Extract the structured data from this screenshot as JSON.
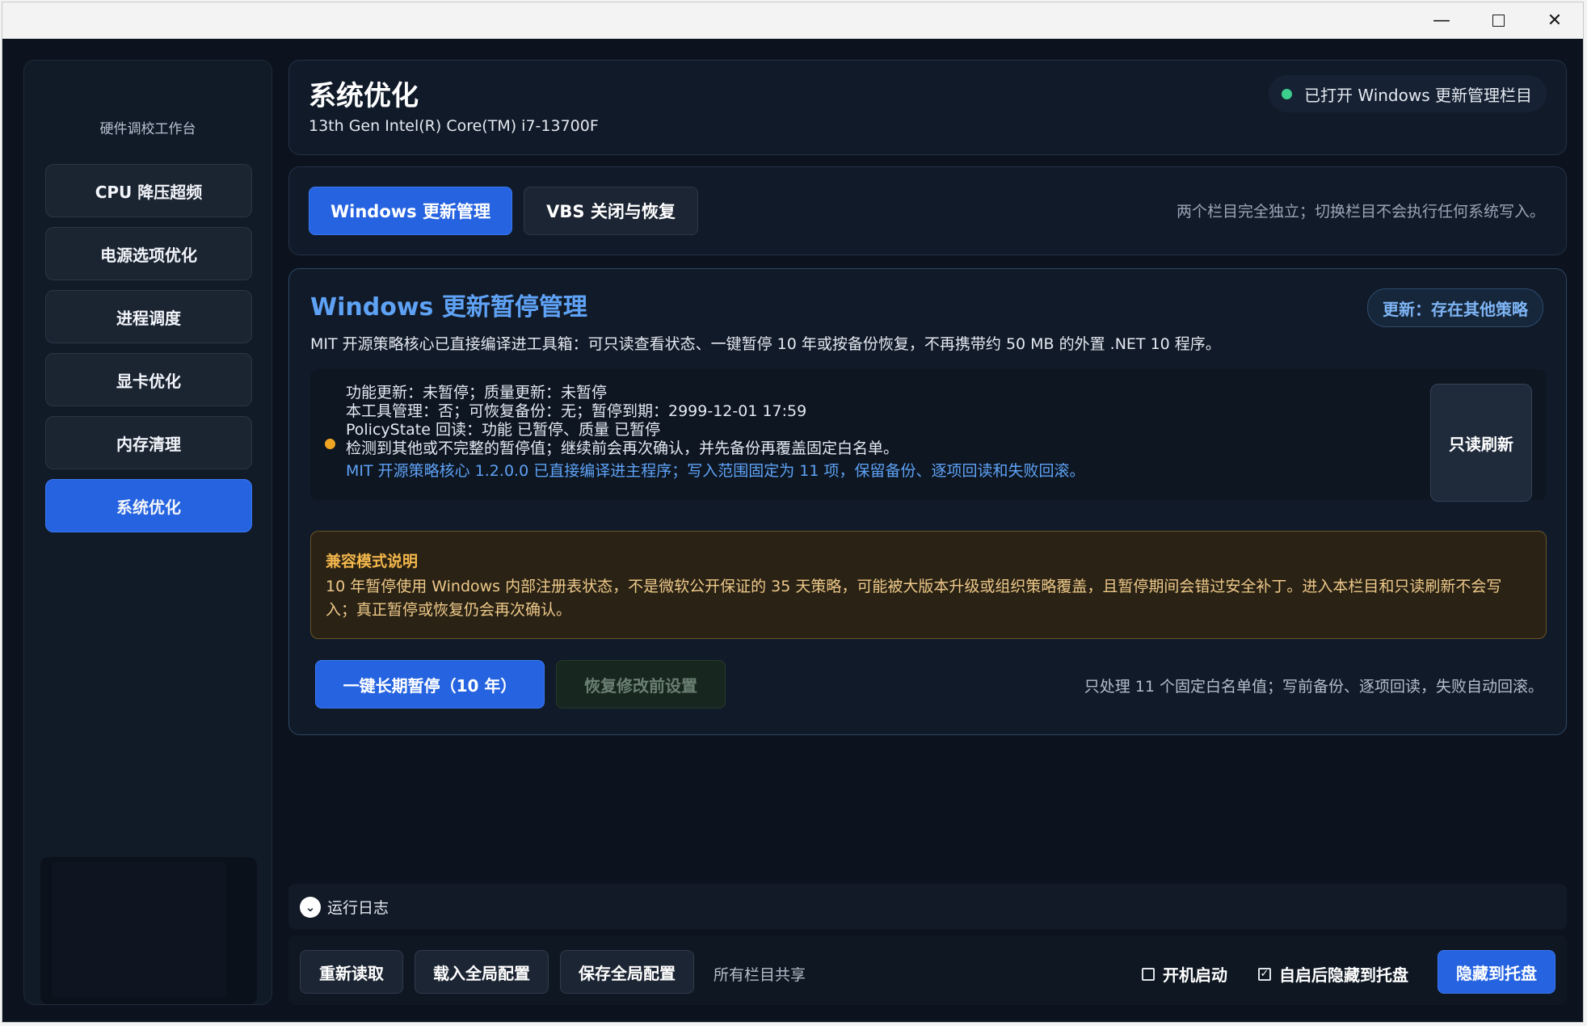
{
  "window": {
    "minimize_icon": "minimize-icon",
    "maximize_icon": "maximize-icon",
    "close_icon": "close-icon"
  },
  "sidebar": {
    "title": "硬件调校工作台",
    "items": [
      {
        "label": "CPU 降压超频",
        "active": false
      },
      {
        "label": "电源选项优化",
        "active": false
      },
      {
        "label": "进程调度",
        "active": false
      },
      {
        "label": "显卡优化",
        "active": false
      },
      {
        "label": "内存清理",
        "active": false
      },
      {
        "label": "系统优化",
        "active": true
      }
    ]
  },
  "header": {
    "title": "系统优化",
    "subtitle": "13th Gen Intel(R) Core(TM) i7-13700F",
    "status": "已打开 Windows 更新管理栏目",
    "status_color": "#3ccf8e"
  },
  "tabs": {
    "items": [
      {
        "label": "Windows 更新管理",
        "active": true
      },
      {
        "label": "VBS 关闭与恢复",
        "active": false
      }
    ],
    "note": "两个栏目完全独立；切换栏目不会执行任何系统写入。"
  },
  "update_panel": {
    "title": "Windows 更新暂停管理",
    "description": "MIT 开源策略核心已直接编译进工具箱：可只读查看状态、一键暂停 10 年或按备份恢复，不再携带约 50 MB 的外置 .NET 10 程序。",
    "policy_badge": "更新：存在其他策略",
    "status_lines": [
      "功能更新：未暂停；质量更新：未暂停",
      "本工具管理：否；可恢复备份：无；暂停到期：2999-12-01 17:59",
      "PolicyState 回读：功能 已暂停、质量 已暂停",
      "检测到其他或不完整的暂停值；继续前会再次确认，并先备份再覆盖固定白名单。"
    ],
    "core_info": "MIT 开源策略核心 1.2.0.0 已直接编译进主程序；写入范围固定为 11 项，保留备份、逐项回读和失败回滚。",
    "warning_color": "#f0a522",
    "refresh_label": "只读刷新",
    "compat_title": "兼容模式说明",
    "compat_text": "10 年暂停使用 Windows 内部注册表状态，不是微软公开保证的 35 天策略，可能被大版本升级或组织策略覆盖，且暂停期间会错过安全补丁。进入本栏目和只读刷新不会写入；真正暂停或恢复仍会再次确认。",
    "pause_label": "一键长期暂停（10 年）",
    "restore_label": "恢复修改前设置",
    "action_note": "只处理 11 个固定白名单值；写前备份、逐项回读，失败自动回滚。"
  },
  "log": {
    "label": "运行日志",
    "icon": "chevron-down-icon"
  },
  "footer": {
    "reload_label": "重新读取",
    "load_label": "载入全局配置",
    "save_label": "保存全局配置",
    "shared_note": "所有栏目共享",
    "autostart_label": "开机启动",
    "autostart_checked": false,
    "hide_label": "自启后隐藏到托盘",
    "hide_checked": true,
    "tray_label": "隐藏到托盘"
  },
  "colors": {
    "accent": "#2563e0",
    "background": "#0c131e",
    "title_blue": "#5ea2f5",
    "warning_text": "#f3b74c"
  }
}
